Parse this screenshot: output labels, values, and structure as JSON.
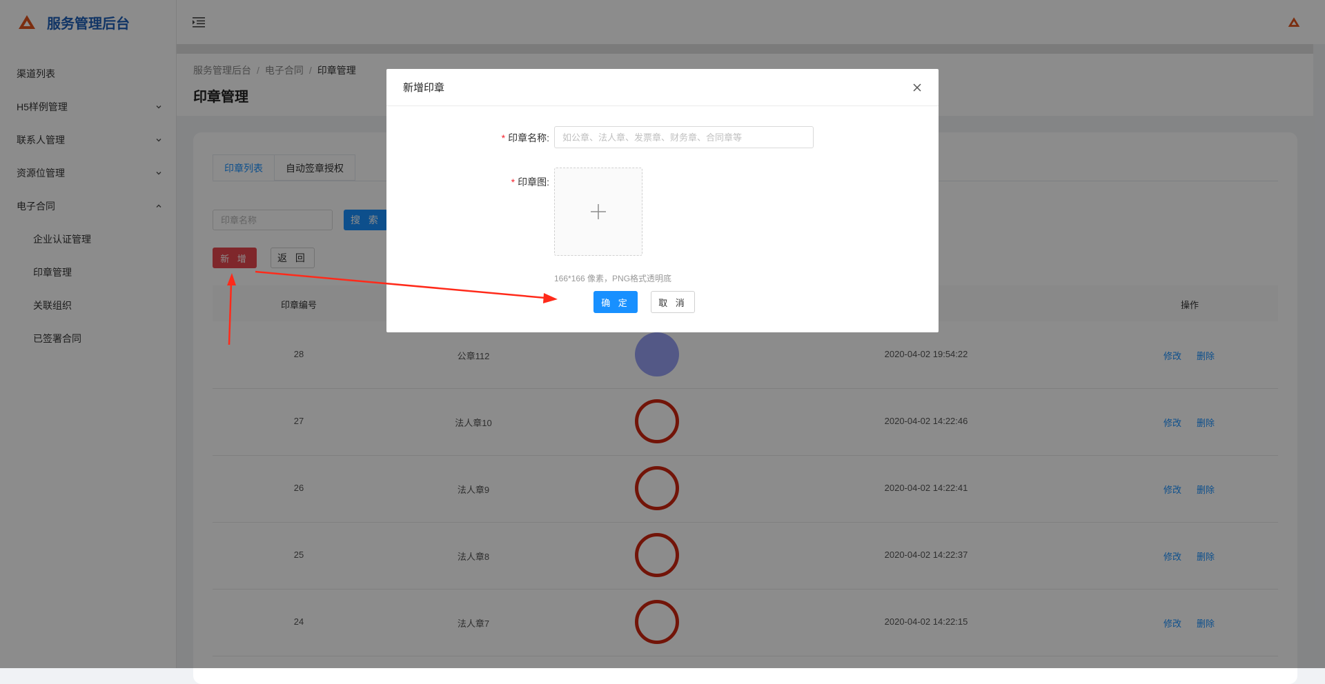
{
  "app": {
    "title": "服务管理后台"
  },
  "sidebar": {
    "items": [
      {
        "label": "渠道列表",
        "chevron": ""
      },
      {
        "label": "H5样例管理",
        "chevron": "down"
      },
      {
        "label": "联系人管理",
        "chevron": "down"
      },
      {
        "label": "资源位管理",
        "chevron": "down"
      },
      {
        "label": "电子合同",
        "chevron": "up"
      }
    ],
    "subitems": [
      {
        "label": "企业认证管理"
      },
      {
        "label": "印章管理"
      },
      {
        "label": "关联组织"
      },
      {
        "label": "已签署合同"
      }
    ]
  },
  "breadcrumb": [
    "服务管理后台",
    "电子合同",
    "印章管理"
  ],
  "page": {
    "title": "印章管理"
  },
  "tabs": [
    "印章列表",
    "自动签章授权"
  ],
  "search": {
    "placeholder": "印章名称",
    "button": "搜 索"
  },
  "actions": {
    "add": "新 增",
    "back": "返 回"
  },
  "table": {
    "headers": [
      "印章编号",
      "操作"
    ],
    "rows": [
      {
        "id": "28",
        "name": "公章112",
        "time": "2020-04-02 19:54:22",
        "seal": "blue"
      },
      {
        "id": "27",
        "name": "法人章10",
        "time": "2020-04-02 14:22:46",
        "seal": "red"
      },
      {
        "id": "26",
        "name": "法人章9",
        "time": "2020-04-02 14:22:41",
        "seal": "red"
      },
      {
        "id": "25",
        "name": "法人章8",
        "time": "2020-04-02 14:22:37",
        "seal": "red"
      },
      {
        "id": "24",
        "name": "法人章7",
        "time": "2020-04-02 14:22:15",
        "seal": "red"
      }
    ],
    "edit": "修改",
    "delete": "删除"
  },
  "modal": {
    "title": "新增印章",
    "name_label": "印章名称:",
    "name_placeholder": "如公章、法人章、发票章、财务章、合同章等",
    "image_label": "印章图:",
    "hint": "166*166 像素，PNG格式透明底",
    "ok": "确 定",
    "cancel": "取 消",
    "required_mark": "*"
  },
  "colors": {
    "brand": "#1e5fb8",
    "primary": "#1890ff",
    "danger": "#e8474f",
    "seal_red": "#d02610",
    "seal_blue": "#97a1f5",
    "arrow": "#ff2a1a"
  },
  "icons": {
    "logo": "triangle-logo-icon",
    "menu_toggle": "hamburger-icon",
    "close": "close-icon",
    "upload": "plus-icon",
    "expand": "chevron-down-icon",
    "collapse": "chevron-up-icon"
  }
}
